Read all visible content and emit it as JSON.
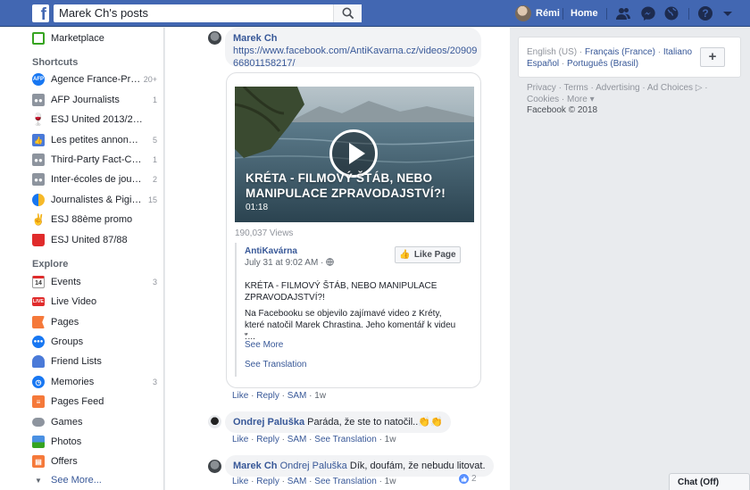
{
  "topbar": {
    "search_value": "Marek Ch's posts",
    "user_name": "Rémi",
    "home_label": "Home"
  },
  "sidebar": {
    "marketplace": "Marketplace",
    "shortcuts_heading": "Shortcuts",
    "shortcuts": [
      {
        "label": "Agence France-Pr…",
        "count": "20+",
        "icon": "afp-logo-icon"
      },
      {
        "label": "AFP Journalists",
        "count": "1",
        "icon": "group-icon"
      },
      {
        "label": "ESJ United 2013/2…",
        "count": "",
        "icon": "wine-glass-icon"
      },
      {
        "label": "Les petites annon…",
        "count": "5",
        "icon": "thumbs-up-icon"
      },
      {
        "label": "Third-Party Fact-C…",
        "count": "1",
        "icon": "group-icon"
      },
      {
        "label": "Inter-écoles de jou…",
        "count": "2",
        "icon": "group-icon"
      },
      {
        "label": "Journalistes & Pigi…",
        "count": "15",
        "icon": "group-avatar-icon"
      },
      {
        "label": "ESJ 88ème promo",
        "count": "",
        "icon": "victory-hand-icon"
      },
      {
        "label": "ESJ United 87/88",
        "count": "",
        "icon": "red-cup-icon"
      }
    ],
    "explore_heading": "Explore",
    "explore": [
      {
        "label": "Events",
        "count": "3",
        "icon": "calendar-icon"
      },
      {
        "label": "Live Video",
        "count": "",
        "icon": "live-icon"
      },
      {
        "label": "Pages",
        "count": "",
        "icon": "flag-icon"
      },
      {
        "label": "Groups",
        "count": "",
        "icon": "groups-icon"
      },
      {
        "label": "Friend Lists",
        "count": "",
        "icon": "friend-list-icon"
      },
      {
        "label": "Memories",
        "count": "3",
        "icon": "memories-icon"
      },
      {
        "label": "Pages Feed",
        "count": "",
        "icon": "pages-feed-icon"
      },
      {
        "label": "Games",
        "count": "",
        "icon": "game-controller-icon"
      },
      {
        "label": "Photos",
        "count": "",
        "icon": "photos-icon"
      },
      {
        "label": "Offers",
        "count": "",
        "icon": "offers-icon"
      }
    ],
    "see_more": "See More...",
    "live_badge": "LIVE",
    "calendar_day": "14"
  },
  "post": {
    "author": "Marek Ch",
    "link": "https://www.facebook.com/AntiKavarna.cz/videos/2090966801158217/",
    "link_line1": "https://www.facebook.com/AntiKavarna.cz/videos/20909",
    "link_line2": "66801158217/",
    "video_title": "KRÉTA - FILMOVÝ ŠTÁB, NEBO MANIPULACE ZPRAVODAJSTVÍ?!",
    "video_duration": "01:18",
    "views": "190,037 Views",
    "page_name": "AntiKavárna",
    "page_date": "July 31 at 9:02 AM ·",
    "like_page": "Like Page",
    "page_title_text": "KRÉTA - FILMOVÝ ŠTÁB, NEBO MANIPULACE ZPRAVODAJSTVÍ?!",
    "page_body": "Na Facebooku se objevilo zajímavé video z Kréty, které natočil Marek Chrastina. Jeho komentář k videu :",
    "page_quote": "\"...",
    "see_more": "See More",
    "see_translation": "See Translation",
    "actions": {
      "like": "Like",
      "reply": "Reply",
      "sam": "SAM",
      "time": "1w"
    }
  },
  "comments": [
    {
      "author": "Ondrej Paluška",
      "text": "Paráda, že ste to natočil..",
      "emoji": "👏👏",
      "actions": {
        "like": "Like",
        "reply": "Reply",
        "sam": "SAM",
        "translation": "See Translation",
        "time": "1w"
      }
    },
    {
      "author": "Marek Ch",
      "mention": "Ondrej Paluška",
      "text": "Dík, doufám, že nebudu litovat.",
      "actions": {
        "like": "Like",
        "reply": "Reply",
        "sam": "SAM",
        "translation": "See Translation",
        "time": "1w"
      },
      "reactions": "2"
    }
  ],
  "right": {
    "lang_current": "English (US)",
    "langs": [
      "Français (France)",
      "Italiano",
      "Español",
      "Português (Brasil)"
    ],
    "footer_links": [
      "Privacy",
      "Terms",
      "Advertising",
      "Ad Choices",
      "Cookies",
      "More"
    ],
    "copyright": "Facebook © 2018"
  },
  "chat": {
    "label": "Chat (Off)"
  },
  "colors": {
    "brand": "#4267b2",
    "link": "#385898",
    "background": "#e9ebee"
  }
}
